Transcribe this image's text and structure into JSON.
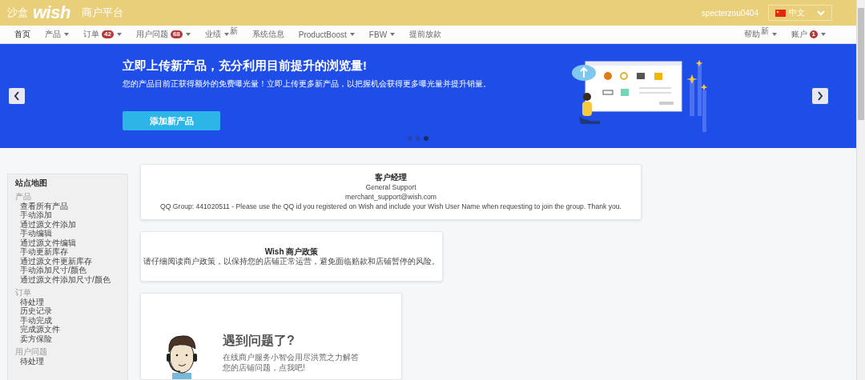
{
  "header": {
    "sandbox_label": "沙盒",
    "logo": "wish",
    "platform": "商户平台",
    "username": "specterzou0404",
    "language": "中文"
  },
  "nav": {
    "items": [
      {
        "label": "首页",
        "caret": false,
        "selected": true
      },
      {
        "label": "产品",
        "caret": true,
        "selected": false
      },
      {
        "label": "订单",
        "badge": "42",
        "caret": true,
        "selected": false
      },
      {
        "label": "用户问题",
        "badge": "68",
        "caret": true,
        "selected": false
      },
      {
        "label": "业绩",
        "caret": true,
        "superscript": "新",
        "selected": false
      },
      {
        "label": "系统信息",
        "caret": false,
        "selected": false
      },
      {
        "label": "ProductBoost",
        "caret": true,
        "selected": false
      },
      {
        "label": "FBW",
        "caret": true,
        "selected": false
      },
      {
        "label": "提前放款",
        "caret": false,
        "selected": false
      }
    ],
    "right_items": [
      {
        "label": "帮助",
        "superscript": "新",
        "caret": true,
        "selected": false
      },
      {
        "label": "账户",
        "badge": "1",
        "caret": true,
        "selected": false
      }
    ]
  },
  "banner": {
    "title": "立即上传新产品，充分利用目前提升的浏览量!",
    "subtitle": "您的产品目前正获得额外的免费曝光量！立即上传更多新产品，以把握机会获得更多曝光量并提升销量。",
    "button": "添加新产品",
    "dots": [
      {
        "selected": false
      },
      {
        "selected": false
      },
      {
        "selected": true
      }
    ]
  },
  "sidebar": {
    "title": "站点地图",
    "sections": [
      {
        "heading": "产品",
        "items": [
          "查看所有产品",
          "手动添加",
          "通过源文件添加",
          "手动编辑",
          "通过源文件编辑",
          "手动更新库存",
          "通过源文件更新库存",
          "手动添加尺寸/颜色",
          "通过源文件添加尺寸/颜色"
        ]
      },
      {
        "heading": "订单",
        "items": [
          "待处理",
          "历史记录",
          "手动完成",
          "完成源文件",
          "卖方保险"
        ]
      },
      {
        "heading": "用户问题",
        "items": [
          "待处理"
        ]
      }
    ]
  },
  "account_manager": {
    "title": "客户经理",
    "name": "General Support",
    "email": "merchant_support@wish.com",
    "note": "QQ Group: 441020511 - Please use the QQ id you registered on Wish and include your Wish User Name when requesting to join the group. Thank you."
  },
  "policy": {
    "title": "Wish 商户政策",
    "text": "请仔细阅读商户政策，以保持您的店铺正常运营，避免面临赔款和店铺暂停的风险。"
  },
  "help": {
    "title": "遇到问题了?",
    "text": "在线商户服务小智会用尽洪荒之力解答您的店铺问题，点我吧!"
  }
}
